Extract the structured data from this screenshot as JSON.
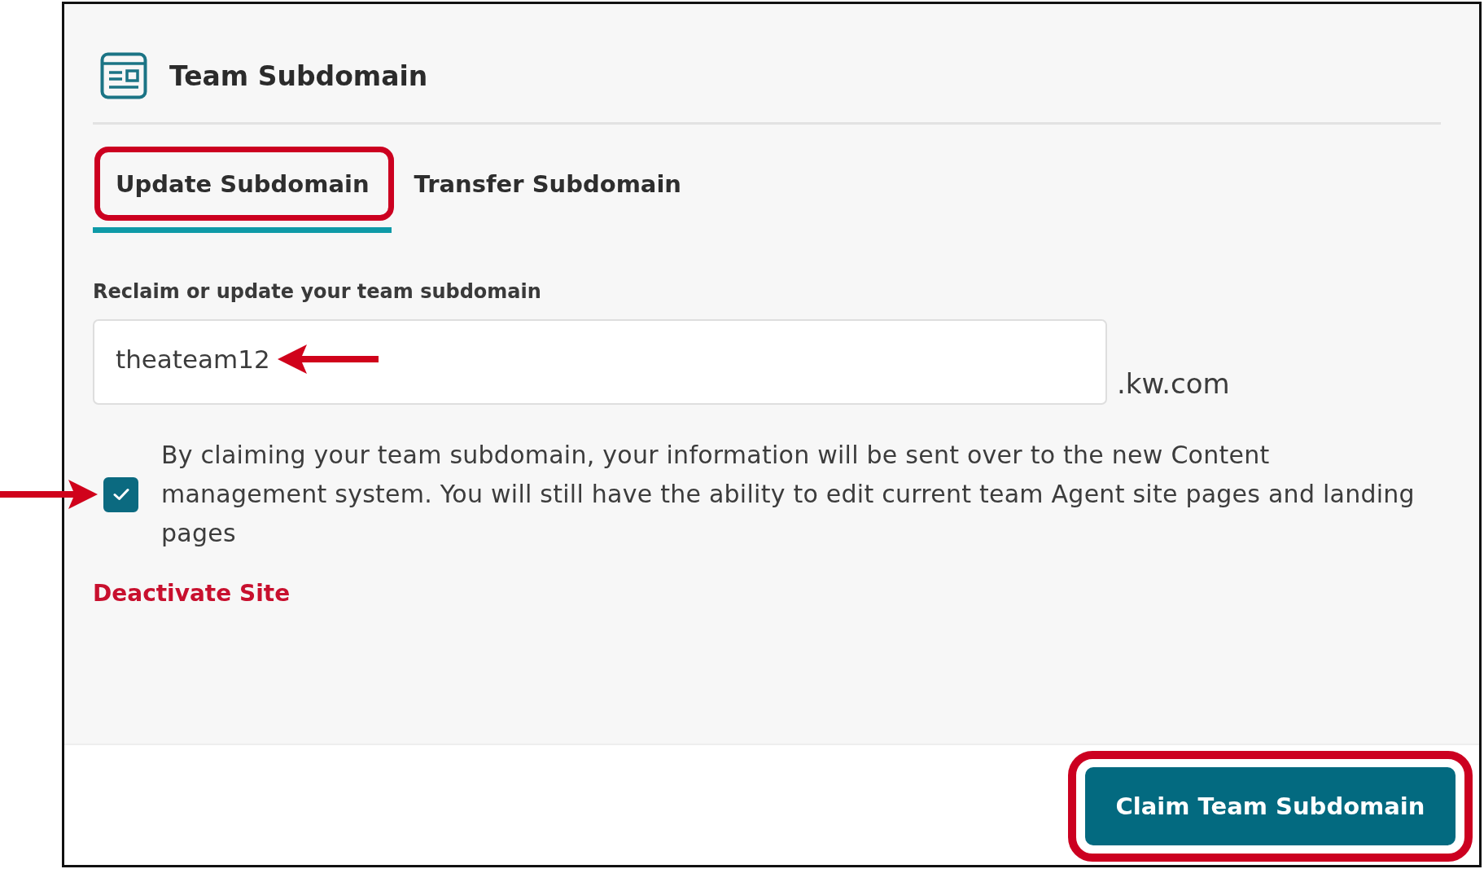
{
  "panel": {
    "title": "Team Subdomain"
  },
  "tabs": [
    {
      "label": "Update Subdomain",
      "selected": true,
      "highlighted": true
    },
    {
      "label": "Transfer Subdomain",
      "selected": false,
      "highlighted": false
    }
  ],
  "subdomain_field": {
    "label": "Reclaim or update your team subdomain",
    "value": "theateam12",
    "suffix": ".kw.com",
    "pointer_arrow": true
  },
  "consent": {
    "checked": true,
    "pointer_arrow": true,
    "text": "By claiming your team subdomain, your information will be sent over to the new Content management system. You will still have the ability to edit current team Agent site pages and landing pages"
  },
  "deactivate_link": "Deactivate Site",
  "footer": {
    "button": {
      "label": "Claim Team Subdomain",
      "highlighted": true
    }
  }
}
